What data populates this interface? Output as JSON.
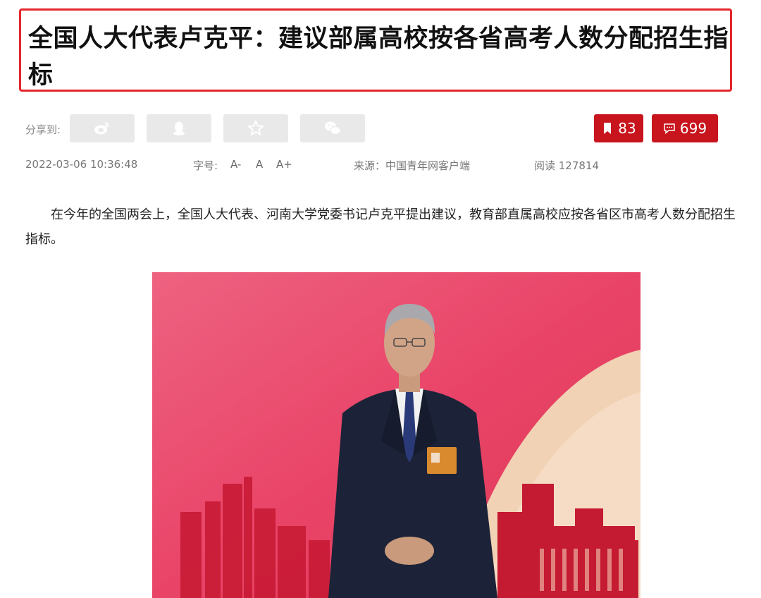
{
  "article": {
    "title": "全国人大代表卢克平：建议部属高校按各省高考人数分配招生指标",
    "share_label": "分享到:",
    "share_buttons": [
      {
        "icon": "weibo-icon"
      },
      {
        "icon": "qq-icon"
      },
      {
        "icon": "favorite-star-icon"
      },
      {
        "icon": "wechat-icon"
      }
    ],
    "bookmark_count": "83",
    "comment_count": "699",
    "date": "2022-03-06 10:36:48",
    "font_size_label": "字号:",
    "font_options": [
      "A-",
      "A",
      "A+"
    ],
    "source": "来源：中国青年网客户端",
    "reads": "阅读 127814",
    "paragraph": "在今年的全国两会上，全国人大代表、河南大学党委书记卢克平提出建议，教育部直属高校应按各省区市高考人数分配招生指标。"
  },
  "colors": {
    "title_border": "#e5262c",
    "count_button": "#c8151d",
    "share_button_bg": "#e9e9e9",
    "photo_background": "#e8315a"
  }
}
